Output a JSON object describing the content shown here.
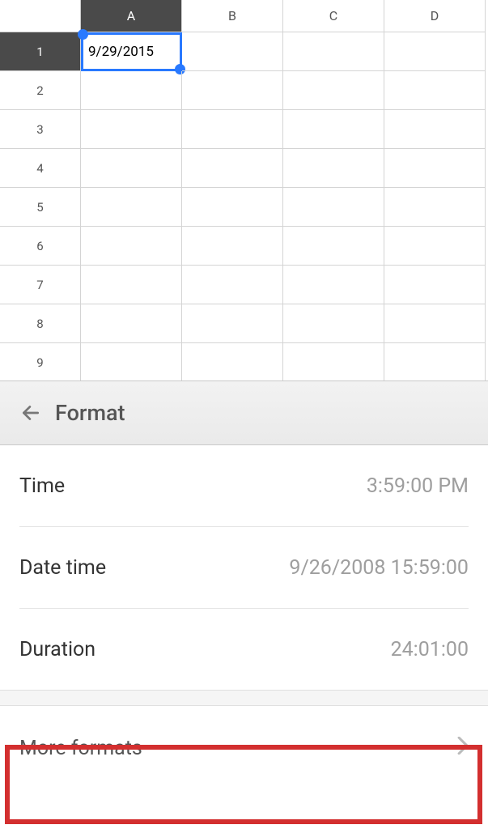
{
  "spreadsheet": {
    "columns": [
      "A",
      "B",
      "C",
      "D"
    ],
    "rows": [
      "1",
      "2",
      "3",
      "4",
      "5",
      "6",
      "7",
      "8",
      "9"
    ],
    "active_col": 0,
    "active_row": 0,
    "selected_cell_value": "9/29/2015"
  },
  "panel": {
    "title": "Format"
  },
  "format_options": [
    {
      "label": "Time",
      "value": "3:59:00 PM"
    },
    {
      "label": "Date time",
      "value": "9/26/2008 15:59:00"
    },
    {
      "label": "Duration",
      "value": "24:01:00"
    }
  ],
  "more_formats_label": "More formats"
}
